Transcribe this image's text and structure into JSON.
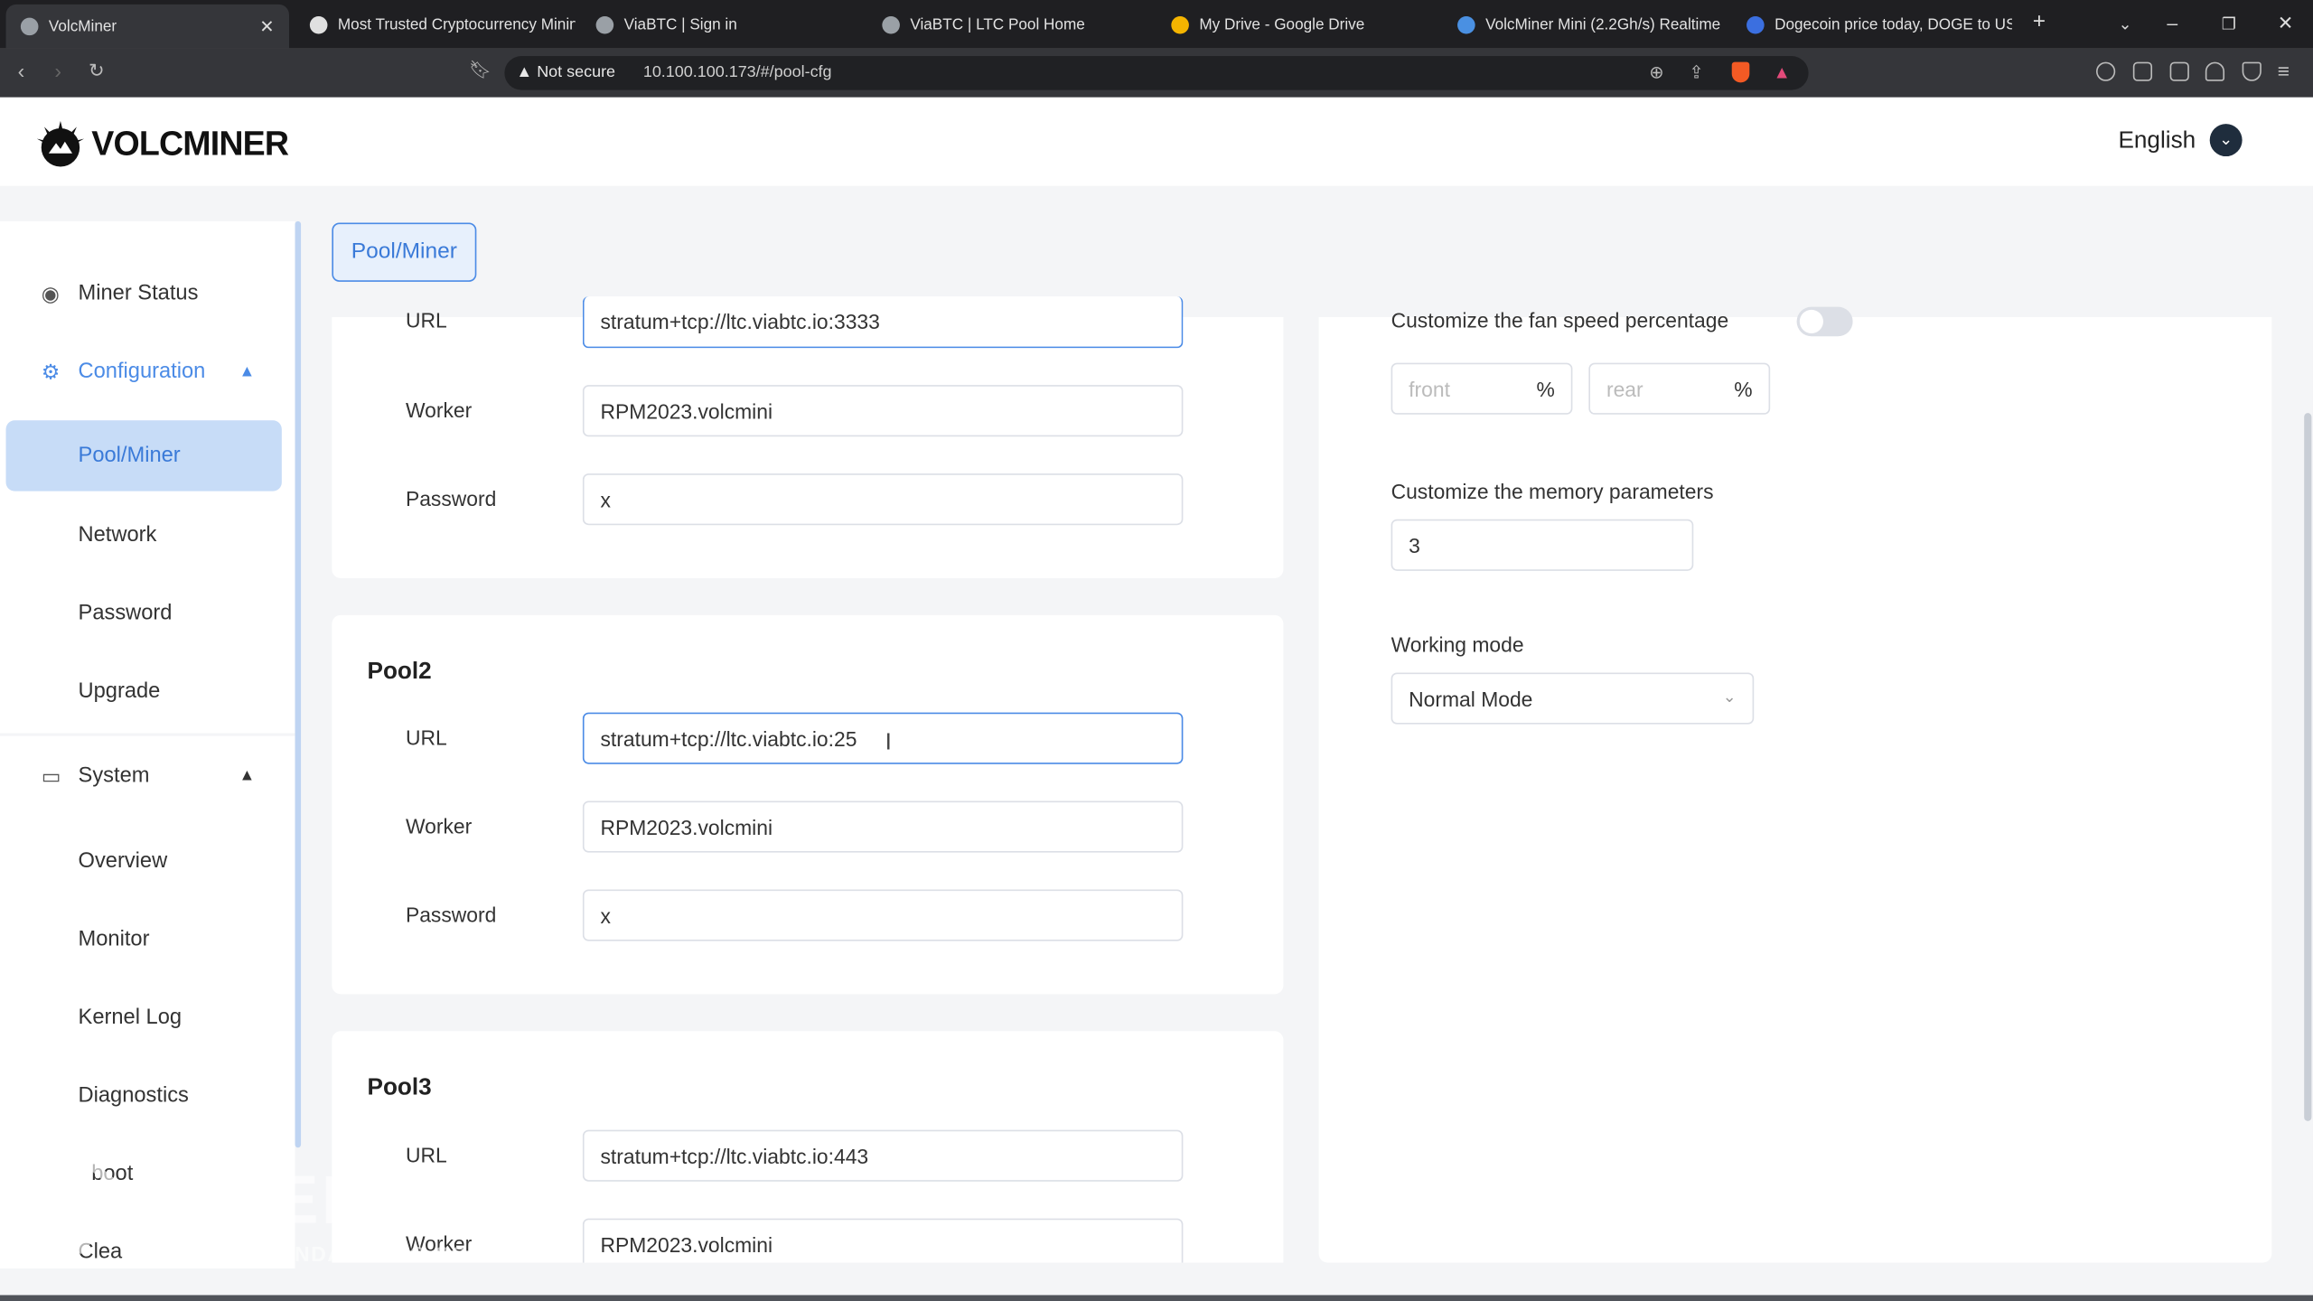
{
  "browser": {
    "tabs": [
      {
        "title": "VolcMiner",
        "active": true,
        "favicon_color": "#9aa0a6"
      },
      {
        "title": "Most Trusted Cryptocurrency Minin",
        "active": false,
        "favicon_color": "#e0e0e0"
      },
      {
        "title": "ViaBTC | Sign in",
        "active": false,
        "favicon_color": "#9aa0a6"
      },
      {
        "title": "ViaBTC | LTC Pool Home",
        "active": false,
        "favicon_color": "#9aa0a6"
      },
      {
        "title": "My Drive - Google Drive",
        "active": false,
        "favicon_color": "#f4b400"
      },
      {
        "title": "VolcMiner Mini (2.2Gh/s) Realtime P",
        "active": false,
        "favicon_color": "#4a90e2"
      },
      {
        "title": "Dogecoin price today, DOGE to USD",
        "active": false,
        "favicon_color": "#3b6fe0"
      }
    ],
    "security_label": "Not secure",
    "url": "10.100.100.173/#/pool-cfg"
  },
  "app": {
    "brand": "VOLCMINER",
    "language": "English"
  },
  "sidebar": {
    "miner_status": "Miner Status",
    "configuration": {
      "label": "Configuration",
      "items": [
        "Pool/Miner",
        "Network",
        "Password",
        "Upgrade"
      ]
    },
    "system": {
      "label": "System",
      "items": [
        "Overview",
        "Monitor",
        "Kernel Log",
        "Diagnostics",
        "boot",
        "Clea"
      ]
    }
  },
  "breadcrumb_tab": "Pool/Miner",
  "pools": {
    "labels": {
      "url": "URL",
      "worker": "Worker",
      "password": "Password"
    },
    "pool1": {
      "url": "stratum+tcp://ltc.viabtc.io:3333",
      "worker": "RPM2023.volcmini",
      "password": "x"
    },
    "pool2": {
      "title": "Pool2",
      "url": "stratum+tcp://ltc.viabtc.io:25",
      "worker": "RPM2023.volcmini",
      "password": "x"
    },
    "pool3": {
      "title": "Pool3",
      "url": "stratum+tcp://ltc.viabtc.io:443",
      "worker": "RPM2023.volcmini",
      "worker_label": "Worker"
    }
  },
  "settings": {
    "fan_label": "Customize the fan speed percentage",
    "fan_enabled": false,
    "front_placeholder": "front",
    "rear_placeholder": "rear",
    "percent_unit": "%",
    "memory_label": "Customize the memory parameters",
    "memory_value": "3",
    "mode_label": "Working mode",
    "mode_value": "Normal Mode"
  },
  "watermark": {
    "title": "MINER",
    "subtitle": "WWW.REDPANDAMINING.COM"
  }
}
